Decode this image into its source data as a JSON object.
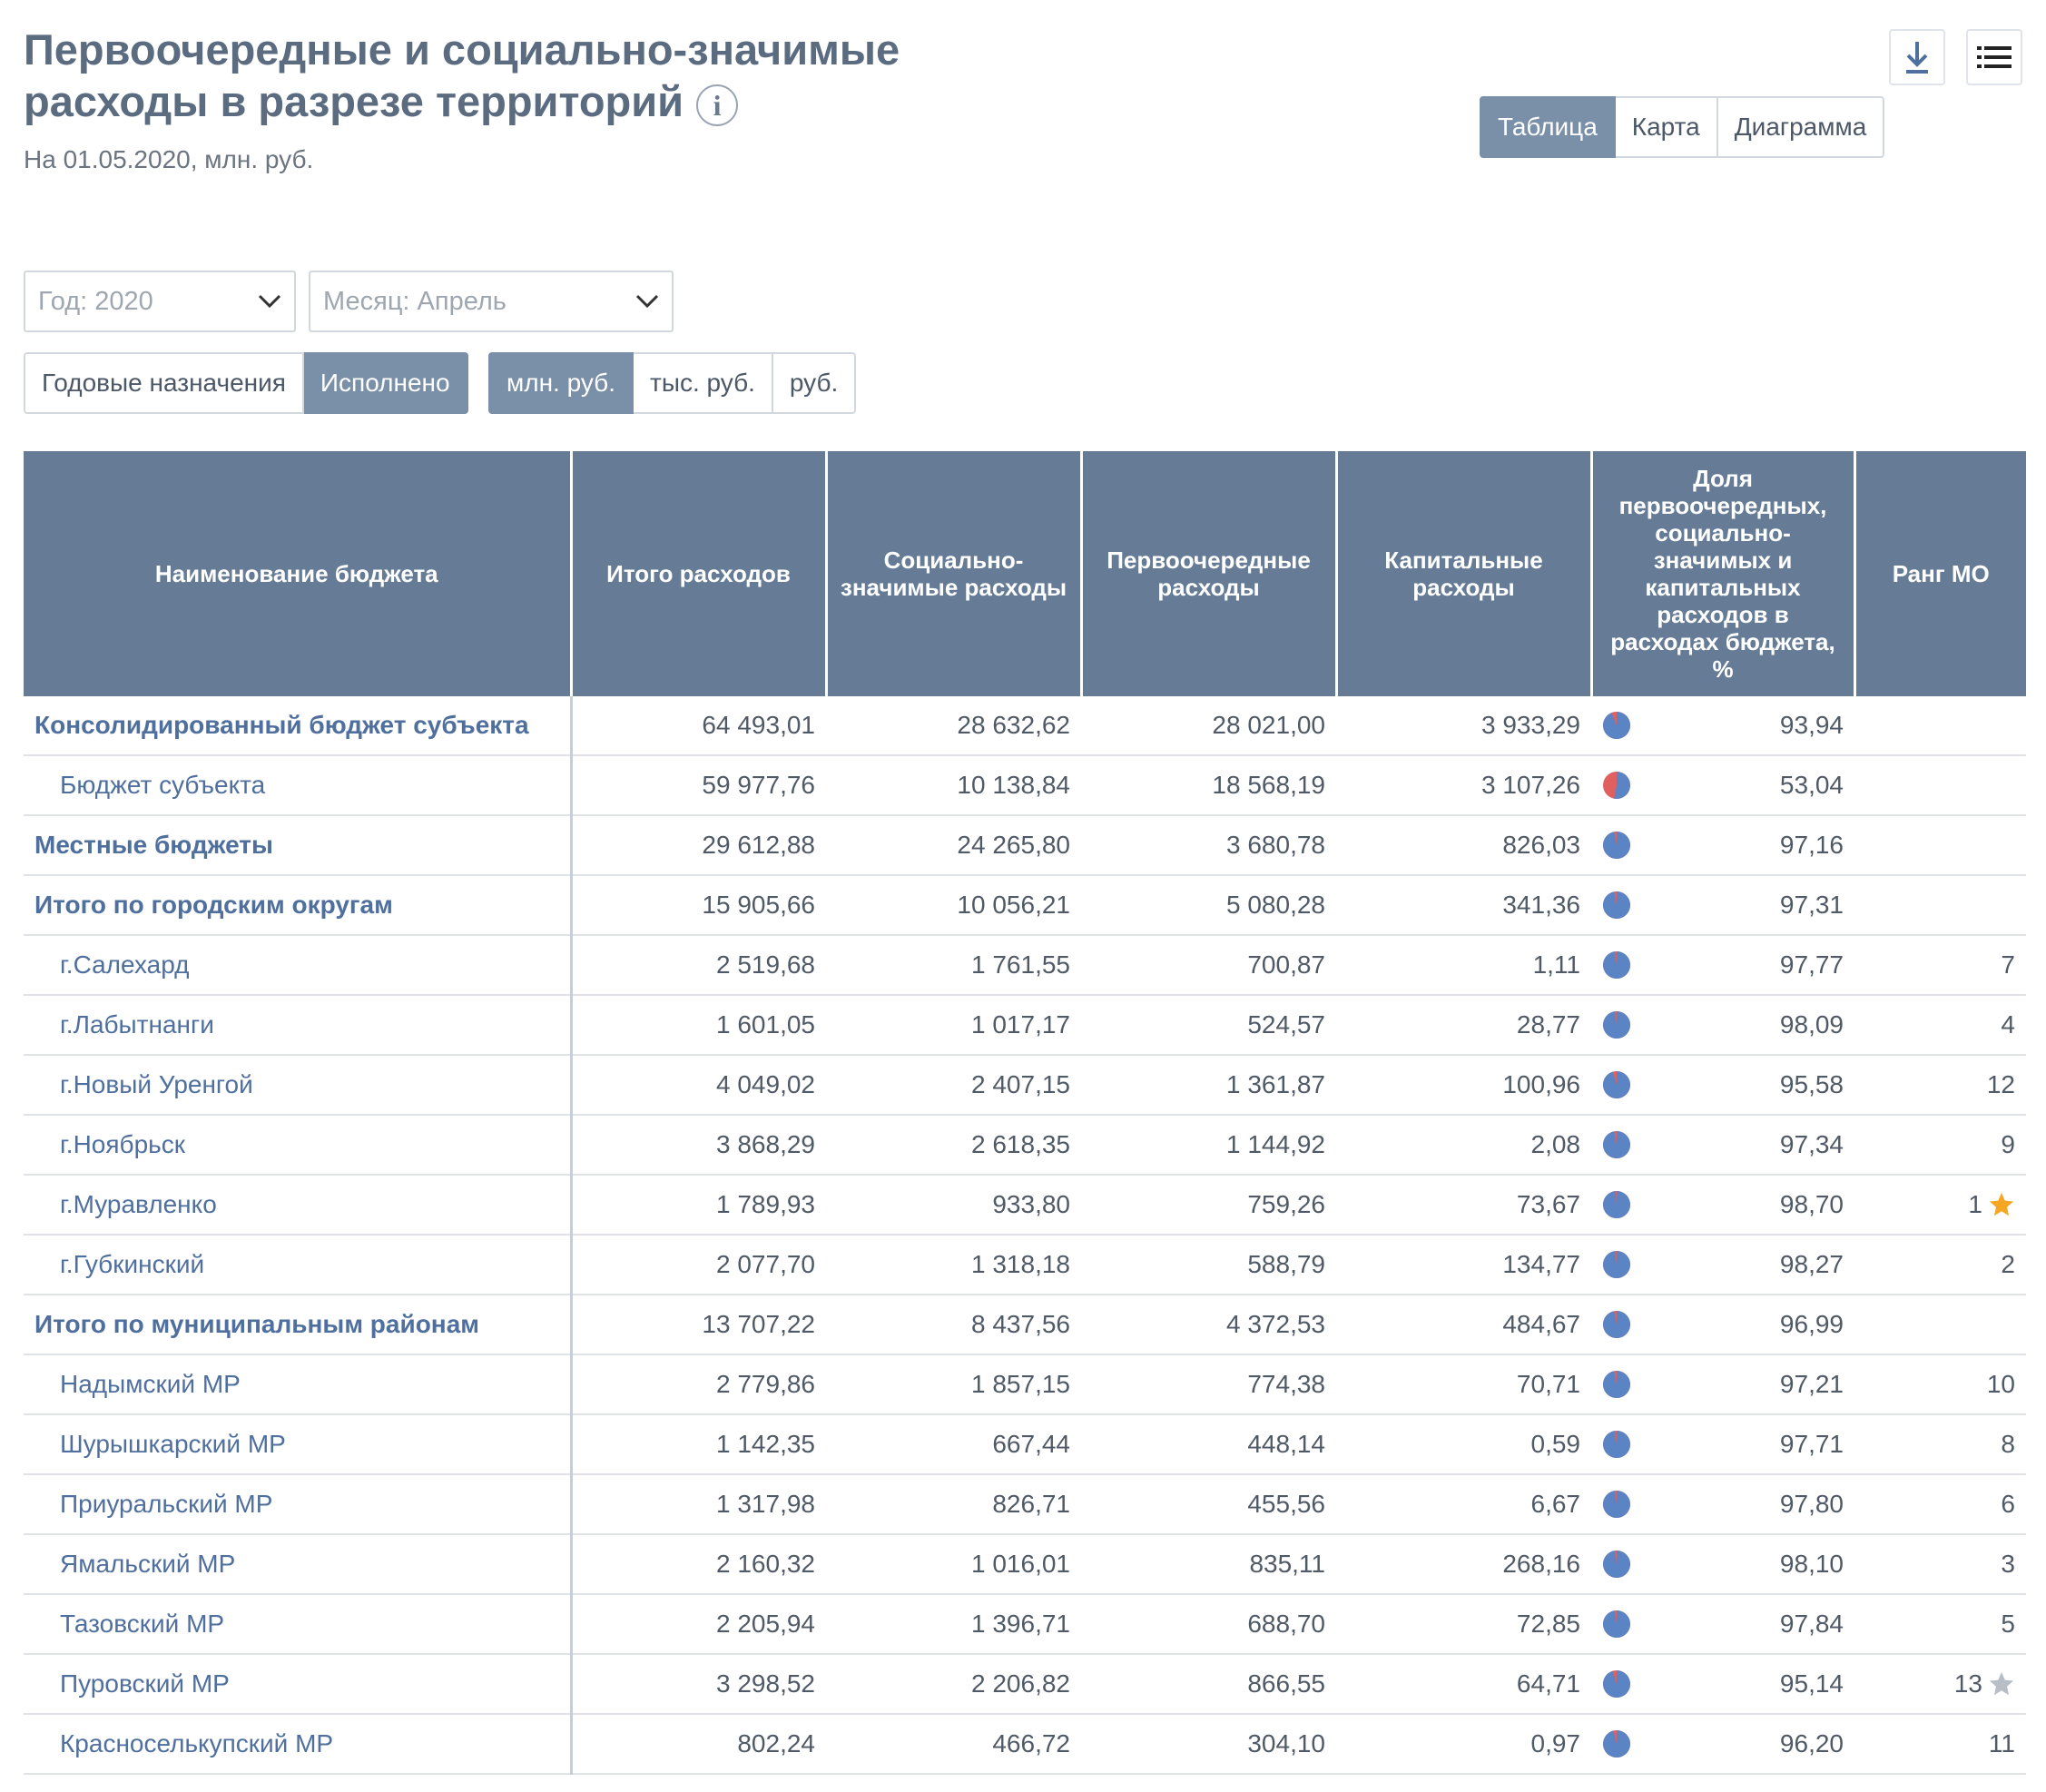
{
  "header": {
    "title_line1": "Первоочередные и социально-значимые",
    "title_line2": "расходы в разрезе территорий",
    "info_glyph": "i",
    "subtitle": "На 01.05.2020, млн. руб."
  },
  "toolbar": {
    "download_icon": "download-icon",
    "menu_icon": "list-icon",
    "view_tabs": [
      "Таблица",
      "Карта",
      "Диаграмма"
    ],
    "active_view": "Таблица"
  },
  "filters": {
    "year": "Год: 2020",
    "month": "Месяц: Апрель",
    "mode_buttons": [
      "Годовые назначения",
      "Исполнено"
    ],
    "active_mode": "Исполнено",
    "unit_buttons": [
      "млн. руб.",
      "тыс. руб.",
      "руб."
    ],
    "active_unit": "млн. руб."
  },
  "table": {
    "headers": [
      "Наименование бюджета",
      "Итого расходов",
      "Социально-значимые расходы",
      "Первоочередные расходы",
      "Капитальные расходы",
      "Доля первоочередных, социально-значимых и капитальных расходов в расходах бюджета, %",
      "Ранг МО"
    ],
    "colors": {
      "header_bg": "#667c96",
      "pie_main": "#5b84c4",
      "pie_rest": "#e06060",
      "star_gold": "#f5a623",
      "star_gray": "#b8bec6"
    },
    "rows": [
      {
        "name": "Консолидированный бюджет субъекта",
        "style": "bold",
        "total": "64 493,01",
        "social": "28 632,62",
        "priority": "28 021,00",
        "capital": "3 933,29",
        "share": "93,94",
        "share_value": 93.94,
        "rank": "",
        "star": ""
      },
      {
        "name": "Бюджет субъекта",
        "style": "indent",
        "total": "59 977,76",
        "social": "10 138,84",
        "priority": "18 568,19",
        "capital": "3 107,26",
        "share": "53,04",
        "share_value": 53.04,
        "rank": "",
        "star": ""
      },
      {
        "name": "Местные бюджеты",
        "style": "bold",
        "total": "29 612,88",
        "social": "24 265,80",
        "priority": "3 680,78",
        "capital": "826,03",
        "share": "97,16",
        "share_value": 97.16,
        "rank": "",
        "star": ""
      },
      {
        "name": "Итого по городским округам",
        "style": "bold",
        "total": "15 905,66",
        "social": "10 056,21",
        "priority": "5 080,28",
        "capital": "341,36",
        "share": "97,31",
        "share_value": 97.31,
        "rank": "",
        "star": ""
      },
      {
        "name": "г.Салехард",
        "style": "indent",
        "total": "2 519,68",
        "social": "1 761,55",
        "priority": "700,87",
        "capital": "1,11",
        "share": "97,77",
        "share_value": 97.77,
        "rank": "7",
        "star": ""
      },
      {
        "name": "г.Лабытнанги",
        "style": "indent",
        "total": "1 601,05",
        "social": "1 017,17",
        "priority": "524,57",
        "capital": "28,77",
        "share": "98,09",
        "share_value": 98.09,
        "rank": "4",
        "star": ""
      },
      {
        "name": "г.Новый Уренгой",
        "style": "indent",
        "total": "4 049,02",
        "social": "2 407,15",
        "priority": "1 361,87",
        "capital": "100,96",
        "share": "95,58",
        "share_value": 95.58,
        "rank": "12",
        "star": ""
      },
      {
        "name": "г.Ноябрьск",
        "style": "indent",
        "total": "3 868,29",
        "social": "2 618,35",
        "priority": "1 144,92",
        "capital": "2,08",
        "share": "97,34",
        "share_value": 97.34,
        "rank": "9",
        "star": ""
      },
      {
        "name": "г.Муравленко",
        "style": "indent",
        "total": "1 789,93",
        "social": "933,80",
        "priority": "759,26",
        "capital": "73,67",
        "share": "98,70",
        "share_value": 98.7,
        "rank": "1",
        "star": "gold"
      },
      {
        "name": "г.Губкинский",
        "style": "indent",
        "total": "2 077,70",
        "social": "1 318,18",
        "priority": "588,79",
        "capital": "134,77",
        "share": "98,27",
        "share_value": 98.27,
        "rank": "2",
        "star": ""
      },
      {
        "name": "Итого по муниципальным районам",
        "style": "bold",
        "total": "13 707,22",
        "social": "8 437,56",
        "priority": "4 372,53",
        "capital": "484,67",
        "share": "96,99",
        "share_value": 96.99,
        "rank": "",
        "star": ""
      },
      {
        "name": "Надымский МР",
        "style": "indent",
        "total": "2 779,86",
        "social": "1 857,15",
        "priority": "774,38",
        "capital": "70,71",
        "share": "97,21",
        "share_value": 97.21,
        "rank": "10",
        "star": ""
      },
      {
        "name": "Шурышкарский МР",
        "style": "indent",
        "total": "1 142,35",
        "social": "667,44",
        "priority": "448,14",
        "capital": "0,59",
        "share": "97,71",
        "share_value": 97.71,
        "rank": "8",
        "star": ""
      },
      {
        "name": "Приуральский МР",
        "style": "indent",
        "total": "1 317,98",
        "social": "826,71",
        "priority": "455,56",
        "capital": "6,67",
        "share": "97,80",
        "share_value": 97.8,
        "rank": "6",
        "star": ""
      },
      {
        "name": "Ямальский МР",
        "style": "indent",
        "total": "2 160,32",
        "social": "1 016,01",
        "priority": "835,11",
        "capital": "268,16",
        "share": "98,10",
        "share_value": 98.1,
        "rank": "3",
        "star": ""
      },
      {
        "name": "Тазовский МР",
        "style": "indent",
        "total": "2 205,94",
        "social": "1 396,71",
        "priority": "688,70",
        "capital": "72,85",
        "share": "97,84",
        "share_value": 97.84,
        "rank": "5",
        "star": ""
      },
      {
        "name": "Пуровский МР",
        "style": "indent",
        "total": "3 298,52",
        "social": "2 206,82",
        "priority": "866,55",
        "capital": "64,71",
        "share": "95,14",
        "share_value": 95.14,
        "rank": "13",
        "star": "gray"
      },
      {
        "name": "Красноселькупский МР",
        "style": "indent",
        "total": "802,24",
        "social": "466,72",
        "priority": "304,10",
        "capital": "0,97",
        "share": "96,20",
        "share_value": 96.2,
        "rank": "11",
        "star": ""
      }
    ]
  }
}
